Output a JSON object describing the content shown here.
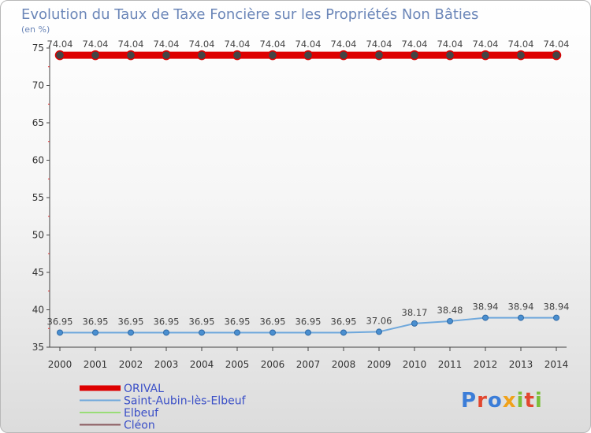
{
  "chart_data": {
    "type": "line",
    "title": "Evolution du Taux de Taxe Foncière sur les Propriétés Non Bâties",
    "ylabel": "(en %)",
    "xlabel": "",
    "ylim": [
      35,
      75
    ],
    "yticks": [
      35,
      40,
      45,
      50,
      55,
      60,
      65,
      70,
      75
    ],
    "categories": [
      "2000",
      "2001",
      "2002",
      "2003",
      "2004",
      "2005",
      "2006",
      "2007",
      "2008",
      "2009",
      "2010",
      "2011",
      "2012",
      "2013",
      "2014"
    ],
    "grid": false,
    "legend_position": "bottom-left",
    "series": [
      {
        "name": "ORIVAL",
        "color": "#dd0000",
        "values": [
          74.04,
          74.04,
          74.04,
          74.04,
          74.04,
          74.04,
          74.04,
          74.04,
          74.04,
          74.04,
          74.04,
          74.04,
          74.04,
          74.04,
          74.04
        ],
        "labels": [
          "74.04",
          "74.04",
          "74.04",
          "74.04",
          "74.04",
          "74.04",
          "74.04",
          "74.04",
          "74.04",
          "74.04",
          "74.04",
          "74.04",
          "74.04",
          "74.04",
          "74.04"
        ]
      },
      {
        "name": "Saint-Aubin-lès-Elbeuf",
        "color": "#6fa8dc",
        "values": [
          36.95,
          36.95,
          36.95,
          36.95,
          36.95,
          36.95,
          36.95,
          36.95,
          36.95,
          37.06,
          38.17,
          38.48,
          38.94,
          38.94,
          38.94
        ],
        "labels": [
          "36.95",
          "36.95",
          "36.95",
          "36.95",
          "36.95",
          "36.95",
          "36.95",
          "36.95",
          "36.95",
          "37.06",
          "38.17",
          "38.48",
          "38.94",
          "38.94",
          "38.94"
        ]
      },
      {
        "name": "Elbeuf",
        "color": "#99dd77",
        "values": [],
        "labels": []
      },
      {
        "name": "Cléon",
        "color": "#8a5a60",
        "values": [],
        "labels": []
      }
    ]
  },
  "branding": {
    "logo_text": "Proxiti"
  }
}
